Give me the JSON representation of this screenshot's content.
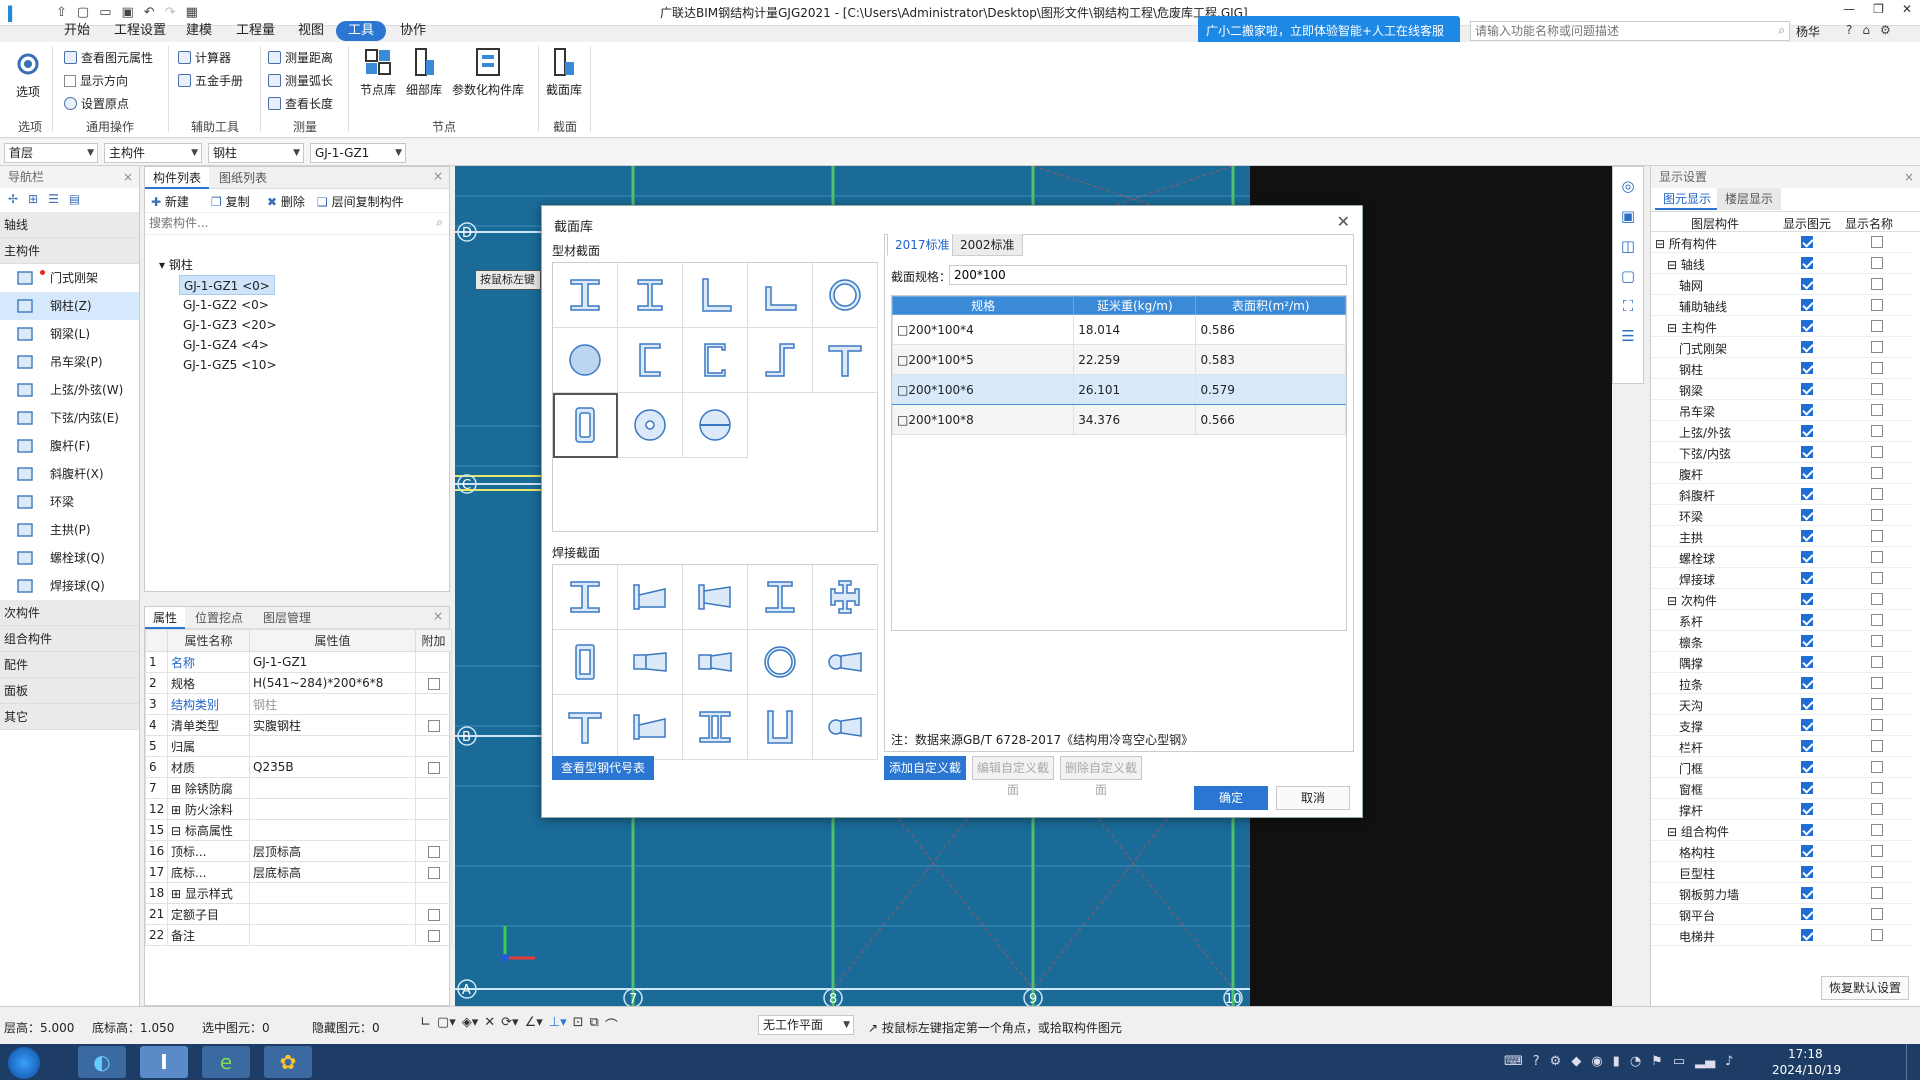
{
  "window": {
    "title": "广联达BIM钢结构计量GJG2021 - [C:\\Users\\Administrator\\Desktop\\图形文件\\钢结构工程\\危废库工程.GJG]",
    "user": "杨华",
    "help_search_placeholder": "请输入功能名称或问题描述",
    "assistant_banner": "广小二搬家啦，立即体验智能+人工在线客服"
  },
  "menu": [
    "开始",
    "工程设置",
    "建模",
    "工程量",
    "视图",
    "工具",
    "协作"
  ],
  "menu_active": "工具",
  "ribbon": {
    "options": "选项",
    "general": [
      "查看图元属性",
      "显示方向",
      "设置原点"
    ],
    "aux": [
      "计算器",
      "五金手册"
    ],
    "measure": [
      "测量距离",
      "测量弧长",
      "查看长度"
    ],
    "nodes": [
      "节点库",
      "细部库",
      "参数化构件库"
    ],
    "section": "截面库",
    "groups": [
      "选项",
      "通用操作",
      "辅助工具",
      "测量",
      "节点",
      "截面"
    ]
  },
  "dropdowns": [
    "首层",
    "主构件",
    "钢柱",
    "GJ-1-GZ1"
  ],
  "nav": {
    "header": "导航栏",
    "cat_axis": "轴线",
    "cat_main": "主构件",
    "items": [
      "门式刚架",
      "钢柱(Z)",
      "钢梁(L)",
      "吊车梁(P)",
      "上弦/外弦(W)",
      "下弦/内弦(E)",
      "腹杆(F)",
      "斜腹杆(X)",
      "环梁",
      "主拱(P)",
      "螺栓球(Q)",
      "焊接球(Q)"
    ],
    "other_cats": [
      "次构件",
      "组合构件",
      "配件",
      "面板",
      "其它"
    ]
  },
  "complist": {
    "tabs": [
      "构件列表",
      "图纸列表"
    ],
    "actions": [
      "新建",
      "复制",
      "删除",
      "层间复制构件"
    ],
    "search_placeholder": "搜索构件...",
    "root": "钢柱",
    "items": [
      "GJ-1-GZ1 <0>",
      "GJ-1-GZ2 <0>",
      "GJ-1-GZ3 <20>",
      "GJ-1-GZ4 <4>",
      "GJ-1-GZ5 <10>"
    ]
  },
  "props": {
    "tabs": [
      "属性",
      "位置挖点",
      "图层管理"
    ],
    "headers": [
      "属性名称",
      "属性值",
      "附加"
    ],
    "rows": [
      {
        "n": "1",
        "name": "名称",
        "value": "GJ-1-GZ1",
        "cb": false,
        "blue": true
      },
      {
        "n": "2",
        "name": "规格",
        "value": "H(541~284)*200*6*8",
        "cb": true,
        "blue": false
      },
      {
        "n": "3",
        "name": "结构类别",
        "value": "钢柱",
        "cb": false,
        "blue": true
      },
      {
        "n": "4",
        "name": "清单类型",
        "value": "实腹钢柱",
        "cb": true,
        "blue": false
      },
      {
        "n": "5",
        "name": "归属",
        "value": "",
        "cb": false,
        "blue": false
      },
      {
        "n": "6",
        "name": "材质",
        "value": "Q235B",
        "cb": true,
        "blue": false
      },
      {
        "n": "7",
        "name": "⊞ 除锈防腐",
        "value": "",
        "cb": false,
        "blue": false
      },
      {
        "n": "12",
        "name": "⊞ 防火涂料",
        "value": "",
        "cb": false,
        "blue": false
      },
      {
        "n": "15",
        "name": "⊟ 标高属性",
        "value": "",
        "cb": false,
        "blue": false
      },
      {
        "n": "16",
        "name": "顶标...",
        "value": "层顶标高",
        "cb": true,
        "blue": false
      },
      {
        "n": "17",
        "name": "底标...",
        "value": "层底标高",
        "cb": true,
        "blue": false
      },
      {
        "n": "18",
        "name": "⊞ 显示样式",
        "value": "",
        "cb": false,
        "blue": false
      },
      {
        "n": "21",
        "name": "定额子目",
        "value": "",
        "cb": true,
        "blue": false
      },
      {
        "n": "22",
        "name": "备注",
        "value": "",
        "cb": true,
        "blue": false
      }
    ]
  },
  "canvas": {
    "axis_labels": [
      "D",
      "C",
      "B",
      "A",
      "7",
      "8",
      "9",
      "10"
    ],
    "tooltip": "按鼠标左键"
  },
  "dialog": {
    "title": "截面库",
    "section_rolled": "型材截面",
    "section_welded": "焊接截面",
    "std_tabs": [
      "2017标准",
      "2002标准"
    ],
    "spec_label": "截面规格：",
    "spec_value": "200*100",
    "table_headers": [
      "规格",
      "延米重(kg/m)",
      "表面积(m²/m)"
    ],
    "rows": [
      {
        "spec": "□200*100*4",
        "w": "18.014",
        "a": "0.586"
      },
      {
        "spec": "□200*100*5",
        "w": "22.259",
        "a": "0.583"
      },
      {
        "spec": "□200*100*6",
        "w": "26.101",
        "a": "0.579"
      },
      {
        "spec": "□200*100*8",
        "w": "34.376",
        "a": "0.566"
      }
    ],
    "note": "注：数据来源GB/T 6728-2017《结构用冷弯空心型钢》",
    "btn_view_codes": "查看型钢代号表",
    "btn_add_custom": "添加自定义截面",
    "btn_edit_custom": "编辑自定义截面",
    "btn_delete_custom": "删除自定义截面",
    "btn_ok": "确定",
    "btn_cancel": "取消"
  },
  "display": {
    "header": "显示设置",
    "tabs": [
      "图元显示",
      "楼层显示"
    ],
    "col_headers": [
      "图层构件",
      "显示图元",
      "显示名称"
    ],
    "rows": [
      {
        "label": "⊟ 所有构件",
        "indent": 0
      },
      {
        "label": "⊟ 轴线",
        "indent": 1
      },
      {
        "label": "轴网",
        "indent": 2
      },
      {
        "label": "辅助轴线",
        "indent": 2
      },
      {
        "label": "⊟ 主构件",
        "indent": 1
      },
      {
        "label": "门式刚架",
        "indent": 2
      },
      {
        "label": "钢柱",
        "indent": 2
      },
      {
        "label": "钢梁",
        "indent": 2
      },
      {
        "label": "吊车梁",
        "indent": 2
      },
      {
        "label": "上弦/外弦",
        "indent": 2
      },
      {
        "label": "下弦/内弦",
        "indent": 2
      },
      {
        "label": "腹杆",
        "indent": 2
      },
      {
        "label": "斜腹杆",
        "indent": 2
      },
      {
        "label": "环梁",
        "indent": 2
      },
      {
        "label": "主拱",
        "indent": 2
      },
      {
        "label": "螺栓球",
        "indent": 2
      },
      {
        "label": "焊接球",
        "indent": 2
      },
      {
        "label": "⊟ 次构件",
        "indent": 1
      },
      {
        "label": "系杆",
        "indent": 2
      },
      {
        "label": "檩条",
        "indent": 2
      },
      {
        "label": "隅撑",
        "indent": 2
      },
      {
        "label": "拉条",
        "indent": 2
      },
      {
        "label": "天沟",
        "indent": 2
      },
      {
        "label": "支撑",
        "indent": 2
      },
      {
        "label": "栏杆",
        "indent": 2
      },
      {
        "label": "门框",
        "indent": 2
      },
      {
        "label": "窗框",
        "indent": 2
      },
      {
        "label": "撑杆",
        "indent": 2
      },
      {
        "label": "⊟ 组合构件",
        "indent": 1
      },
      {
        "label": "格构柱",
        "indent": 2
      },
      {
        "label": "巨型柱",
        "indent": 2
      },
      {
        "label": "钢板剪力墙",
        "indent": 2
      },
      {
        "label": "钢平台",
        "indent": 2
      },
      {
        "label": "电梯井",
        "indent": 2
      }
    ],
    "reset_button": "恢复默认设置"
  },
  "status": {
    "floor_height": "层高：5.000",
    "bottom_elev": "底标高：1.050",
    "selected": "选中图元：0",
    "hidden": "隐藏图元：0",
    "work_plane": "无工作平面",
    "hint": "按鼠标左键指定第一个角点，或拾取构件图元"
  },
  "taskbar": {
    "time": "17:18",
    "date": "2024/10/19"
  },
  "colors": {
    "accent": "#2a76d2",
    "canvas": "#1a6b98",
    "taskbar": "#1d3c66"
  }
}
